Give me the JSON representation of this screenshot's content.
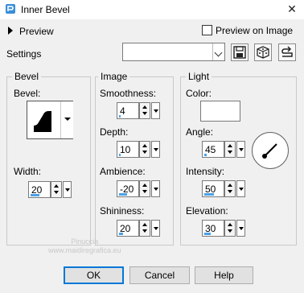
{
  "window": {
    "title": "Inner Bevel",
    "close": "✕"
  },
  "preview": {
    "label": "Preview",
    "preview_on_image": "Preview on Image"
  },
  "settings": {
    "label": "Settings",
    "value": ""
  },
  "groups": {
    "bevel": "Bevel",
    "image": "Image",
    "light": "Light"
  },
  "bevel": {
    "shape_label": "Bevel:",
    "width_label": "Width:",
    "width": "20",
    "width_level": 0.45
  },
  "image": {
    "smoothness_label": "Smoothness:",
    "smoothness": "4",
    "smoothness_level": 0.04,
    "depth_label": "Depth:",
    "depth": "10",
    "depth_level": 0.1,
    "ambience_label": "Ambience:",
    "ambience": "-20",
    "ambience_level": 0.4,
    "shininess_label": "Shininess:",
    "shininess": "20",
    "shininess_level": 0.2
  },
  "light": {
    "color_label": "Color:",
    "color": "#ffffff",
    "angle_label": "Angle:",
    "angle": "45",
    "angle_level": 0.125,
    "intensity_label": "Intensity:",
    "intensity": "50",
    "intensity_level": 0.5,
    "elevation_label": "Elevation:",
    "elevation": "30",
    "elevation_level": 0.33
  },
  "watermark": "Pinuccia\nwww.maidiregrafica.eu",
  "buttons": {
    "ok": "OK",
    "cancel": "Cancel",
    "help": "Help"
  },
  "accent": "#0078d7",
  "icons": {
    "app": "paint-shop-icon",
    "save": "save-icon",
    "random": "dice-icon",
    "reset": "reset-icon"
  }
}
